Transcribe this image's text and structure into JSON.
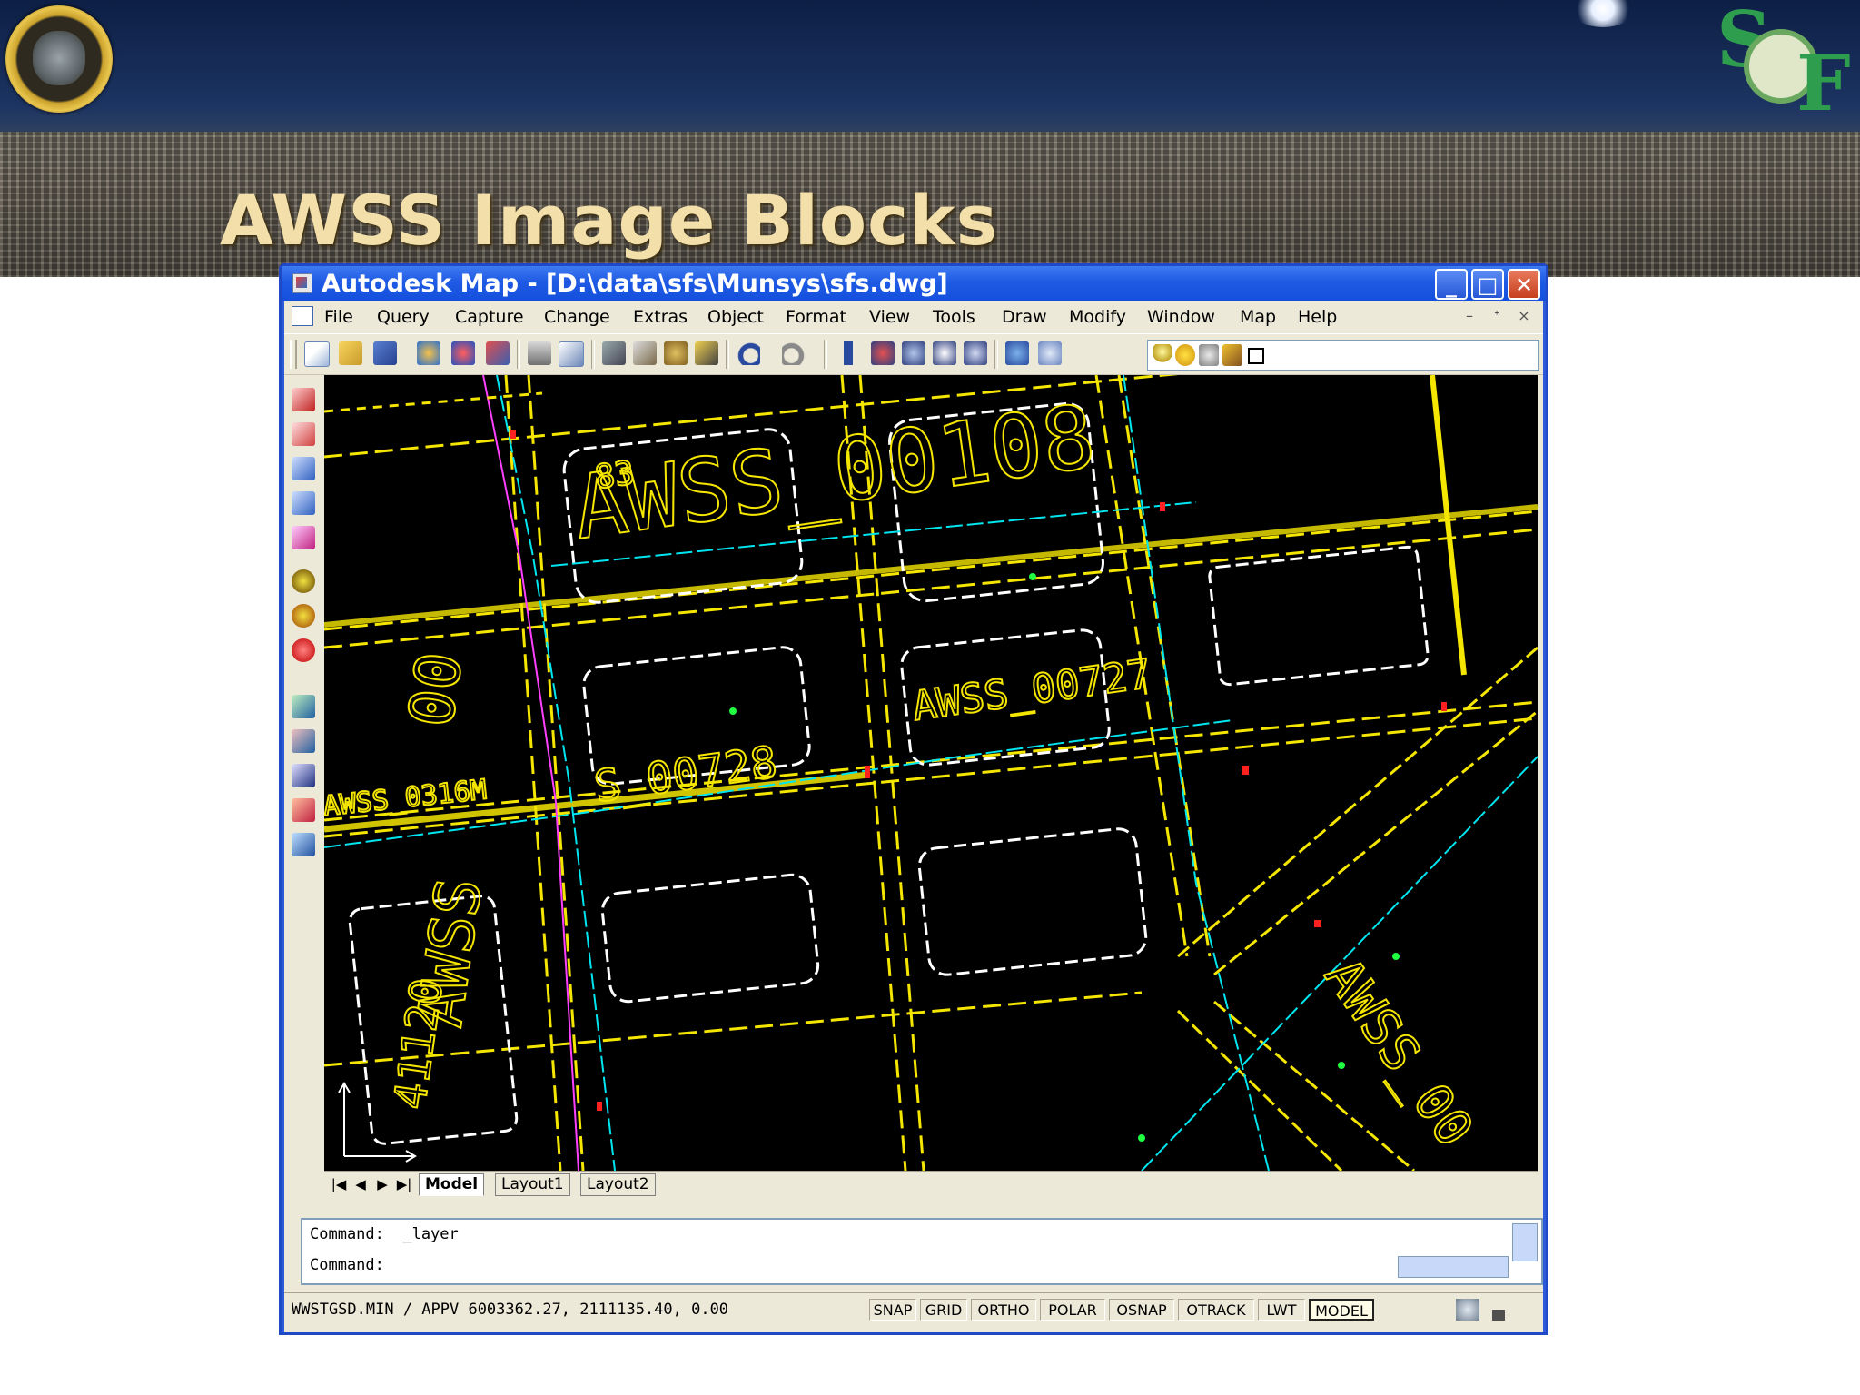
{
  "slide": {
    "title": "AWSS Image Blocks"
  },
  "window": {
    "title": "Autodesk Map - [D:\\data\\sfs\\Munsys\\sfs.dwg]",
    "controls": {
      "minimize": "_",
      "maximize": "□",
      "close": "✕"
    }
  },
  "menu": {
    "items": [
      "File",
      "Query",
      "Capture",
      "Change",
      "Extras",
      "Object",
      "Format",
      "View",
      "Tools",
      "Draw",
      "Modify",
      "Window",
      "Map",
      "Help"
    ],
    "mdi_controls": [
      "–",
      "ᐩ",
      "×"
    ]
  },
  "toolbar": {
    "icons": [
      "new-icon",
      "open-icon",
      "save-icon",
      "publish-icon",
      "plot-icon",
      "copy-icon",
      "print-icon",
      "preview-icon",
      "cut-icon",
      "paste-icon",
      "match-icon",
      "brush-icon",
      "undo-icon",
      "redo-icon",
      "pan-icon",
      "zoom-realtime-icon",
      "zoom-window-icon",
      "zoom-previous-icon",
      "zoom-extents-icon",
      "properties-icon",
      "design-center-icon",
      "layer-bulb-icon",
      "layer-sun-icon",
      "layer-lock-icon",
      "layer-color-icon"
    ]
  },
  "left_toolbar": {
    "icons": [
      "select-icon",
      "window-select-icon",
      "query-icon",
      "attach-icon",
      "zoom-icon",
      "locate-icon",
      "navigate-icon",
      "info-icon",
      "layer-tool-icon",
      "edit-tool-icon",
      "trace-icon",
      "paint-icon",
      "export-icon"
    ]
  },
  "drawing": {
    "labels": {
      "awss_00108": "AWSS_00108",
      "awss_00727": "AWSS_00727",
      "awss_00728": "S_00728",
      "awss_0316m": "AWSS_0316M",
      "awss_left_a": "AWSS",
      "awss_left_b": "00",
      "num_00": "00",
      "num_83": "83",
      "awss_right": "AWSS_00",
      "num_41120": "41120"
    }
  },
  "layout_tabs": {
    "nav": [
      "|◀",
      "◀",
      "▶",
      "▶|"
    ],
    "tabs": [
      "Model",
      "Layout1",
      "Layout2"
    ],
    "active": "Model"
  },
  "command": {
    "line1": "Command:  _layer",
    "line2": "Command:"
  },
  "status": {
    "coords": "WWSTGSD.MIN / APPV  6003362.27, 2111135.40, 0.00",
    "toggles": [
      "SNAP",
      "GRID",
      "ORTHO",
      "POLAR",
      "OSNAP",
      "OTRACK",
      "LWT",
      "MODEL"
    ],
    "active_toggle": "MODEL"
  },
  "colors": {
    "titlebar": "#1f5ae4",
    "window_bg": "#ece9d8",
    "canvas": "#000000",
    "street_yellow": "#f5e600",
    "parcel_white": "#ffffff",
    "main_cyan": "#00e6f0",
    "pipe_magenta": "#ff40ff",
    "valve_red": "#ff2020",
    "hydrant_green": "#20ff40",
    "slide_title": "#f2dfaa"
  }
}
